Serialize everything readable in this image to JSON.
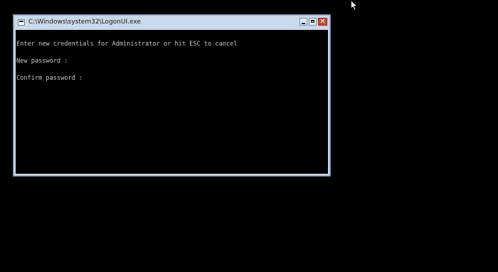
{
  "window": {
    "title": "C:\\Windows\\system32\\LogonUI.exe",
    "icon": "console-app-icon",
    "controls": {
      "minimize": "minimize-icon",
      "maximize": "maximize-icon",
      "close": "close-icon",
      "close_glyph": "✕"
    },
    "colors": {
      "frame": "#c7d9ea",
      "close_button": "#c94a3c",
      "console_background": "#000000",
      "console_text": "#c8c8c8"
    }
  },
  "console": {
    "lines": [
      "Enter new credentials for Administrator or hit ESC to cancel",
      "New password :",
      "Confirm password :"
    ]
  },
  "desktop": {
    "background": "#000000",
    "cursor": "arrow-pointer-icon"
  }
}
